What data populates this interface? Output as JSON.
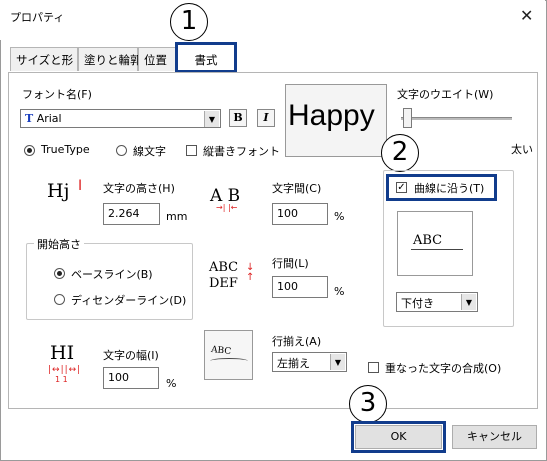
{
  "window": {
    "title": "プロパティ",
    "close_glyph": "✕"
  },
  "tabs": [
    {
      "label": "サイズと形"
    },
    {
      "label": "塗りと輪郭"
    },
    {
      "label": "位置"
    },
    {
      "label": "書式"
    }
  ],
  "font": {
    "label": "フォント名(F)",
    "value": "Arial",
    "type_glyph": "T",
    "bold_label": "B",
    "italic_label": "I",
    "options": [
      {
        "label": "TrueType",
        "selected": true
      },
      {
        "label": "線文字",
        "selected": false
      }
    ],
    "vertical_label": "縦書きフォント",
    "preview_text": "Happy"
  },
  "weight": {
    "label": "文字のウエイト(W)",
    "max_label": "太い",
    "level": 0.05
  },
  "height": {
    "label": "文字の高さ(H)",
    "value": "2.264",
    "unit": "mm",
    "icon_text": "Hj"
  },
  "spacing": {
    "label": "文字間(C)",
    "value": "100",
    "unit": "%",
    "icon_text": "A B"
  },
  "start_height": {
    "title": "開始高さ",
    "options": [
      {
        "label": "ベースライン(B)",
        "selected": true
      },
      {
        "label": "ディセンダーライン(D)",
        "selected": false
      }
    ]
  },
  "line_spacing": {
    "label": "行間(L)",
    "value": "100",
    "unit": "%",
    "icon_line1": "ABC",
    "icon_line2": "DEF"
  },
  "width": {
    "label": "文字の幅(I)",
    "value": "100",
    "unit": "%",
    "icon_text": "HI",
    "icon_sub": "1 1"
  },
  "align": {
    "label": "行揃え(A)",
    "value": "左揃え",
    "icon_text": "ABC"
  },
  "curve": {
    "label": "曲線に沿う(T)",
    "checked": true,
    "preview_text": "ABC",
    "position_value": "下付き"
  },
  "overlap": {
    "label": "重なった文字の合成(O)",
    "checked": false
  },
  "buttons": {
    "ok": "OK",
    "cancel": "キャンセル"
  },
  "callouts": [
    "1",
    "2",
    "3"
  ],
  "colors": {
    "highlight": "#113c8c",
    "icon_red": "#dd2222"
  }
}
